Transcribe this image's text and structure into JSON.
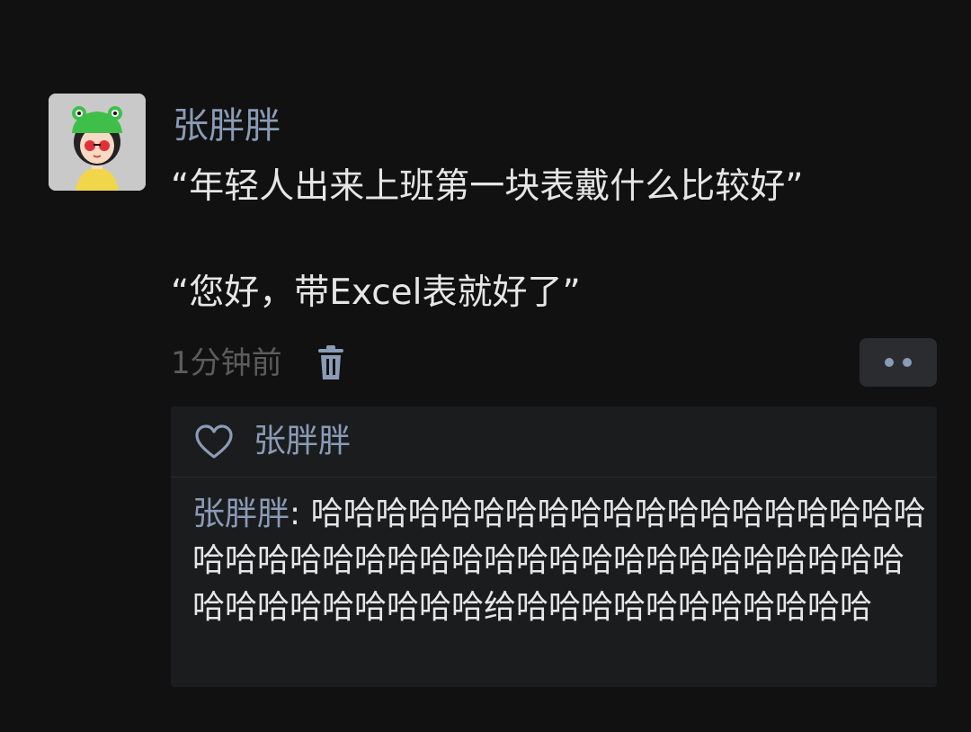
{
  "post": {
    "author": "张胖胖",
    "content_line1": "“年轻人出来上班第一块表戴什么比较好”",
    "content_line2": "“您好，带Excel表就好了”",
    "time": "1分钟前",
    "avatar_icon": "cartoon-girl-frog-hat-avatar",
    "delete_icon": "trash-icon",
    "more_icon": "more-dots-icon"
  },
  "likes": {
    "icon": "heart-icon",
    "names": "张胖胖"
  },
  "comments": [
    {
      "author": "张胖胖",
      "separator": ": ",
      "text": "哈哈哈哈哈哈哈哈哈哈哈哈哈哈哈哈哈哈哈哈哈哈哈哈哈哈哈哈哈哈哈哈哈哈哈哈哈哈哈哈哈哈哈哈哈哈哈哈哈哈给哈哈哈哈哈哈哈哈哈哈哈"
    }
  ],
  "colors": {
    "background": "#111111",
    "name_accent": "#8a9bb6",
    "text": "#e6e6e6",
    "muted": "#5c5c5c",
    "comment_bg": "#1b1c1e"
  }
}
